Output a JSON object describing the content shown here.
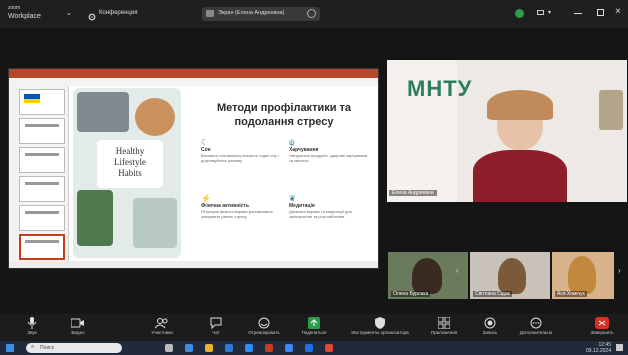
{
  "titlebar": {
    "app_line1": "zoom",
    "app_line2": "Workplace",
    "menu_label": "Конференция",
    "tab_label": "Экран (Елена Андреевна)"
  },
  "slide": {
    "title_line1": "Методи профілактики та",
    "title_line2": "подолання стресу",
    "healthy_line1": "Healthy",
    "healthy_line2": "Lifestyle",
    "healthy_line3": "Habits",
    "items": [
      {
        "title": "Сон",
        "text": "Визначте оптимальну кількість годин сну і дотримуйтесь режиму."
      },
      {
        "title": "Харчування",
        "text": "Натуральні продукти, здорове харчування та свіжість."
      },
      {
        "title": "Фізична активність",
        "text": "Регулярні фізичні вправи допомагають знижувати рівень стресу."
      },
      {
        "title": "Медитація",
        "text": "Дихальні вправи та медитації для заспокоєння та розслаблення."
      }
    ]
  },
  "cameras": {
    "main_logo": "МНТУ",
    "main_name": "Елена Андреевна",
    "small": [
      {
        "name": "Олена Бурлака"
      },
      {
        "name": "Світлана Сідак"
      },
      {
        "name": "Ася Хомічук"
      }
    ]
  },
  "toolbar": {
    "items": [
      {
        "label": "Звук",
        "icon": "microphone-icon"
      },
      {
        "label": "Видео",
        "icon": "video-camera-icon"
      },
      {
        "label": "Участники",
        "icon": "participants-icon"
      },
      {
        "label": "Чат",
        "icon": "chat-icon"
      },
      {
        "label": "Отреагировать",
        "icon": "react-icon"
      },
      {
        "label": "Поделиться",
        "icon": "share-screen-icon"
      },
      {
        "label": "Инструменты организатора",
        "icon": "host-tools-icon"
      },
      {
        "label": "Приложения",
        "icon": "apps-icon"
      },
      {
        "label": "Запись",
        "icon": "record-icon"
      },
      {
        "label": "Дополнительно",
        "icon": "more-icon"
      },
      {
        "label": "Завершить",
        "icon": "end-call-icon"
      }
    ]
  },
  "taskbar": {
    "search_placeholder": "Поиск",
    "time": "12:45",
    "date": "09.12.2024"
  },
  "colors": {
    "accent_green": "#2e9d4b",
    "powerpoint_red": "#b7472a",
    "end_red": "#d93025"
  }
}
